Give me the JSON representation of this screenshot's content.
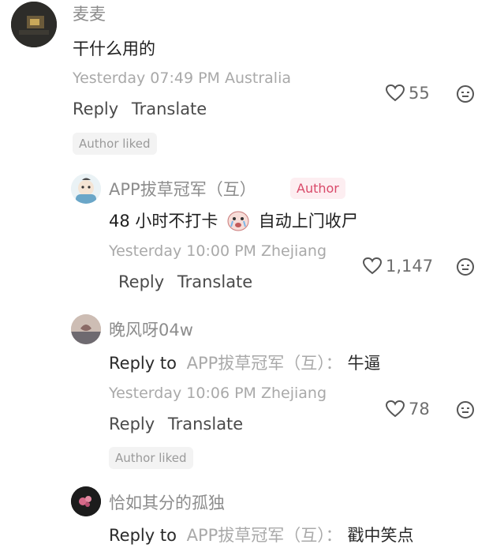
{
  "comments": [
    {
      "username": "麦麦",
      "text": "干什么用的",
      "meta": "Yesterday 07:49 PM Australia",
      "likes": "55",
      "badge": "Author liked",
      "reply": "Reply",
      "translate": "Translate"
    },
    {
      "username": "APP拔草冠军（互）",
      "author_tag": "Author",
      "text_before": "48 小时不打卡",
      "text_after": "自动上门收尸",
      "meta": "Yesterday 10:00 PM Zhejiang",
      "likes": "1,147",
      "reply": "Reply",
      "translate": "Translate"
    },
    {
      "username": "晚风呀04w",
      "reply_prefix": "Reply to",
      "reply_target": "APP拔草冠军（互）：",
      "text": "牛逼",
      "meta": "Yesterday 10:06 PM Zhejiang",
      "likes": "78",
      "badge": "Author liked",
      "reply": "Reply",
      "translate": "Translate"
    },
    {
      "username": "恰如其分的孤独",
      "reply_prefix": "Reply to",
      "reply_target": "APP拔草冠军（互）：",
      "text": "戳中笑点"
    }
  ],
  "colors": {
    "meta": "#a9a9a9",
    "username": "#8c8c8c",
    "author_tag": "#d94a6a"
  }
}
